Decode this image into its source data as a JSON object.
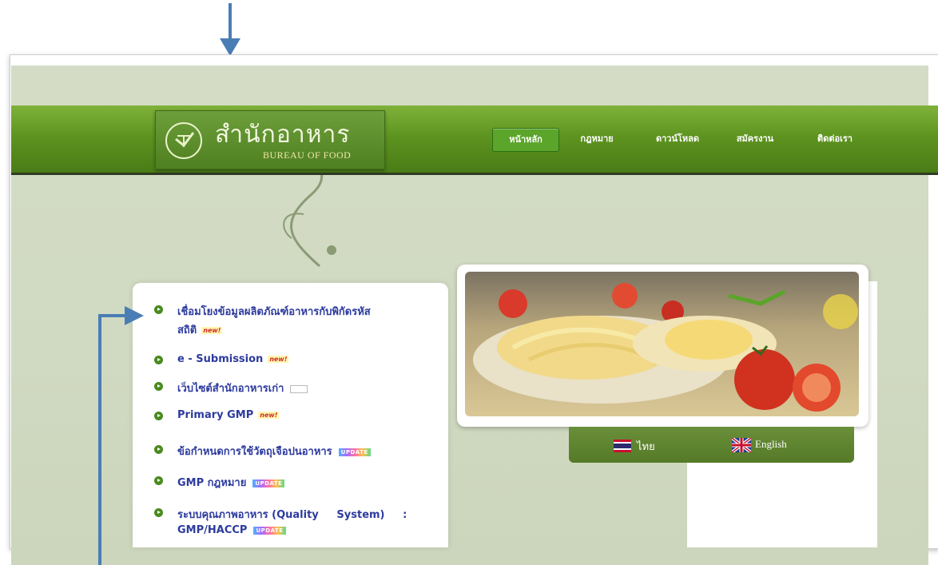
{
  "header": {
    "logo_th": "สำนักอาหาร",
    "logo_en": "BUREAU OF FOOD"
  },
  "nav": {
    "items": [
      {
        "label": "หน้าหลัก",
        "active": true
      },
      {
        "label": "กฎหมาย",
        "active": false
      },
      {
        "label": "ดาวน์โหลด",
        "active": false
      },
      {
        "label": "สมัครงาน",
        "active": false
      },
      {
        "label": "ติดต่อเรา",
        "active": false
      }
    ]
  },
  "menu": {
    "items": [
      {
        "line1": "เชื่อมโยงข้อมูลผลิตภัณฑ์อาหารกับพิกัดรหัส",
        "line2": "สถิติ",
        "badge": "new!"
      },
      {
        "line1": "e - Submission",
        "badge": "new!"
      },
      {
        "line1": "เว็บไซต์สำนักอาหารเก่า",
        "badge": ""
      },
      {
        "line1": "Primary GMP",
        "badge": "new!"
      },
      {
        "line1": "ข้อกำหนดการใช้วัตถุเจือปนอาหาร",
        "badge": "UPDATE"
      },
      {
        "line1": "GMP กฎหมาย",
        "badge": "UPDATE"
      },
      {
        "line1": "ระบบคุณภาพอาหาร (Quality     System)     :",
        "line2": "GMP/HACCP",
        "badge": "UPDATE"
      }
    ]
  },
  "languages": {
    "thai": "ไทย",
    "english": "English"
  },
  "colors": {
    "nav_green": "#5e9420",
    "accent_blue": "#4a7db5",
    "link_blue": "#2d3b9e"
  }
}
